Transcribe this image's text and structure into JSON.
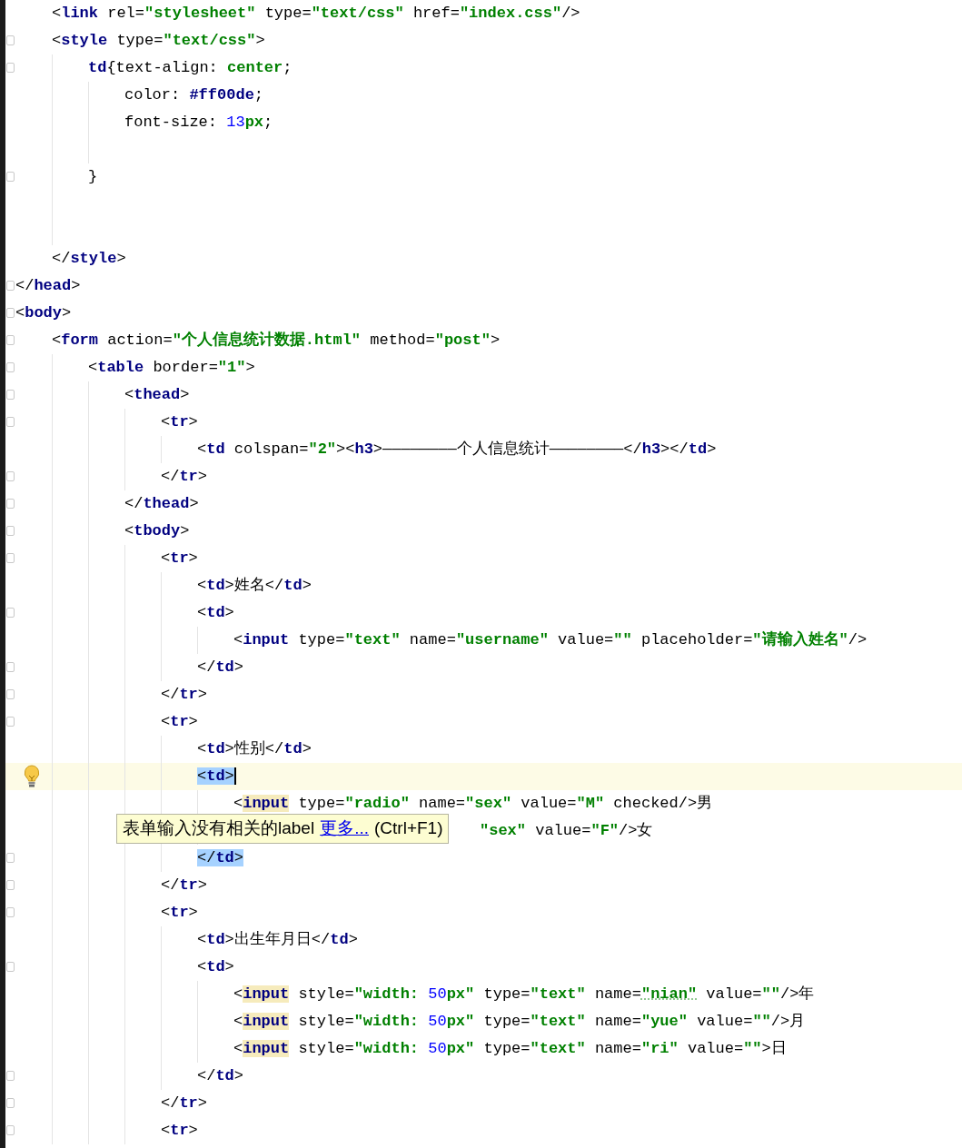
{
  "editor": {
    "lines": [
      {
        "children": [
          {
            "tokens": [
              {
                "kind": "p",
                "text": "<"
              },
              {
                "kind": "tag",
                "text": "link"
              },
              {
                "kind": "attr",
                "text": " rel="
              },
              {
                "kind": "str",
                "text": "\"stylesheet\""
              },
              {
                "kind": "attr",
                "text": " type="
              },
              {
                "kind": "str",
                "text": "\"text/css\""
              },
              {
                "kind": "attr",
                "text": " href="
              },
              {
                "kind": "str",
                "text": "\"index.css\""
              },
              {
                "kind": "p",
                "text": "/>"
              }
            ]
          },
          {
            "fold": true,
            "tokens": [
              {
                "kind": "p",
                "text": "<"
              },
              {
                "kind": "tag",
                "text": "style"
              },
              {
                "kind": "attr",
                "text": " type="
              },
              {
                "kind": "str",
                "text": "\"text/css\""
              },
              {
                "kind": "p",
                "text": ">"
              }
            ],
            "children": [
              {
                "fold": true,
                "tokens": [
                  {
                    "kind": "tag",
                    "text": "td"
                  },
                  {
                    "kind": "p",
                    "text": "{text-align: "
                  },
                  {
                    "kind": "str",
                    "text": "center"
                  },
                  {
                    "kind": "p",
                    "text": ";"
                  }
                ],
                "children": [
                  {
                    "tokens": [
                      {
                        "kind": "p",
                        "text": "color: "
                      },
                      {
                        "kind": "tag",
                        "text": "#ff00de"
                      },
                      {
                        "kind": "p",
                        "text": ";"
                      }
                    ]
                  },
                  {
                    "tokens": [
                      {
                        "kind": "p",
                        "text": "font-size: "
                      },
                      {
                        "kind": "num",
                        "text": "13"
                      },
                      {
                        "kind": "str",
                        "text": "px"
                      },
                      {
                        "kind": "p",
                        "text": ";"
                      }
                    ]
                  },
                  {
                    "kind": "blank"
                  }
                ]
              },
              {
                "fold": true,
                "tokens": [
                  {
                    "kind": "p",
                    "text": "}"
                  }
                ]
              },
              {
                "kind": "blank"
              },
              {
                "kind": "blank"
              }
            ]
          },
          {
            "tokens": [
              {
                "kind": "p",
                "text": "</"
              },
              {
                "kind": "tag",
                "text": "style"
              },
              {
                "kind": "p",
                "text": ">"
              }
            ]
          }
        ]
      },
      {
        "fold": true,
        "tokens": [
          {
            "kind": "p",
            "text": "</"
          },
          {
            "kind": "tag",
            "text": "head"
          },
          {
            "kind": "p",
            "text": ">"
          }
        ]
      },
      {
        "fold": true,
        "tokens": [
          {
            "kind": "p",
            "text": "<"
          },
          {
            "kind": "tag",
            "text": "body"
          },
          {
            "kind": "p",
            "text": ">"
          }
        ],
        "children": [
          {
            "fold": true,
            "tokens": [
              {
                "kind": "p",
                "text": "<"
              },
              {
                "kind": "tag",
                "text": "form"
              },
              {
                "kind": "attr",
                "text": " action="
              },
              {
                "kind": "str",
                "text": "\"个人信息统计数据.html\""
              },
              {
                "kind": "attr",
                "text": " method="
              },
              {
                "kind": "str",
                "text": "\"post\""
              },
              {
                "kind": "p",
                "text": ">"
              }
            ],
            "children": [
              {
                "fold": true,
                "tokens": [
                  {
                    "kind": "p",
                    "text": "<"
                  },
                  {
                    "kind": "tag",
                    "text": "table"
                  },
                  {
                    "kind": "attr",
                    "text": " border="
                  },
                  {
                    "kind": "str",
                    "text": "\"1\""
                  },
                  {
                    "kind": "p",
                    "text": ">"
                  }
                ],
                "children": [
                  {
                    "fold": true,
                    "tokens": [
                      {
                        "kind": "p",
                        "text": "<"
                      },
                      {
                        "kind": "tag",
                        "text": "thead"
                      },
                      {
                        "kind": "p",
                        "text": ">"
                      }
                    ],
                    "children": [
                      {
                        "fold": true,
                        "tokens": [
                          {
                            "kind": "p",
                            "text": "<"
                          },
                          {
                            "kind": "tag",
                            "text": "tr"
                          },
                          {
                            "kind": "p",
                            "text": ">"
                          }
                        ],
                        "children": [
                          {
                            "tokens": [
                              {
                                "kind": "p",
                                "text": "<"
                              },
                              {
                                "kind": "tag",
                                "text": "td"
                              },
                              {
                                "kind": "attr",
                                "text": " colspan="
                              },
                              {
                                "kind": "str",
                                "text": "\"2\""
                              },
                              {
                                "kind": "p",
                                "text": "><"
                              },
                              {
                                "kind": "tag",
                                "text": "h3"
                              },
                              {
                                "kind": "p",
                                "text": ">————————个人信息统计————————</"
                              },
                              {
                                "kind": "tag",
                                "text": "h3"
                              },
                              {
                                "kind": "p",
                                "text": "></"
                              },
                              {
                                "kind": "tag",
                                "text": "td"
                              },
                              {
                                "kind": "p",
                                "text": ">"
                              }
                            ]
                          }
                        ]
                      },
                      {
                        "fold": true,
                        "tokens": [
                          {
                            "kind": "p",
                            "text": "</"
                          },
                          {
                            "kind": "tag",
                            "text": "tr"
                          },
                          {
                            "kind": "p",
                            "text": ">"
                          }
                        ]
                      }
                    ]
                  },
                  {
                    "fold": true,
                    "tokens": [
                      {
                        "kind": "p",
                        "text": "</"
                      },
                      {
                        "kind": "tag",
                        "text": "thead"
                      },
                      {
                        "kind": "p",
                        "text": ">"
                      }
                    ]
                  },
                  {
                    "fold": true,
                    "tokens": [
                      {
                        "kind": "p",
                        "text": "<"
                      },
                      {
                        "kind": "tag",
                        "text": "tbody"
                      },
                      {
                        "kind": "p",
                        "text": ">"
                      }
                    ],
                    "children": [
                      {
                        "fold": true,
                        "tokens": [
                          {
                            "kind": "p",
                            "text": "<"
                          },
                          {
                            "kind": "tag",
                            "text": "tr"
                          },
                          {
                            "kind": "p",
                            "text": ">"
                          }
                        ],
                        "children": [
                          {
                            "tokens": [
                              {
                                "kind": "p",
                                "text": "<"
                              },
                              {
                                "kind": "tag",
                                "text": "td"
                              },
                              {
                                "kind": "p",
                                "text": ">姓名</"
                              },
                              {
                                "kind": "tag",
                                "text": "td"
                              },
                              {
                                "kind": "p",
                                "text": ">"
                              }
                            ]
                          },
                          {
                            "fold": true,
                            "tokens": [
                              {
                                "kind": "p",
                                "text": "<"
                              },
                              {
                                "kind": "tag",
                                "text": "td"
                              },
                              {
                                "kind": "p",
                                "text": ">"
                              }
                            ],
                            "children": [
                              {
                                "tokens": [
                                  {
                                    "kind": "p",
                                    "text": "<"
                                  },
                                  {
                                    "kind": "tag",
                                    "text": "input"
                                  },
                                  {
                                    "kind": "attr",
                                    "text": " type="
                                  },
                                  {
                                    "kind": "str",
                                    "text": "\"text\""
                                  },
                                  {
                                    "kind": "attr",
                                    "text": " name="
                                  },
                                  {
                                    "kind": "str",
                                    "text": "\"username\""
                                  },
                                  {
                                    "kind": "attr",
                                    "text": " value="
                                  },
                                  {
                                    "kind": "str",
                                    "text": "\"\""
                                  },
                                  {
                                    "kind": "attr",
                                    "text": " placeholder="
                                  },
                                  {
                                    "kind": "str",
                                    "text": "\"请输入姓名\""
                                  },
                                  {
                                    "kind": "p",
                                    "text": "/>"
                                  }
                                ]
                              }
                            ]
                          },
                          {
                            "fold": true,
                            "tokens": [
                              {
                                "kind": "p",
                                "text": "</"
                              },
                              {
                                "kind": "tag",
                                "text": "td"
                              },
                              {
                                "kind": "p",
                                "text": ">"
                              }
                            ]
                          }
                        ]
                      },
                      {
                        "fold": true,
                        "tokens": [
                          {
                            "kind": "p",
                            "text": "</"
                          },
                          {
                            "kind": "tag",
                            "text": "tr"
                          },
                          {
                            "kind": "p",
                            "text": ">"
                          }
                        ]
                      },
                      {
                        "fold": true,
                        "tokens": [
                          {
                            "kind": "p",
                            "text": "<"
                          },
                          {
                            "kind": "tag",
                            "text": "tr"
                          },
                          {
                            "kind": "p",
                            "text": ">"
                          }
                        ],
                        "children": [
                          {
                            "tokens": [
                              {
                                "kind": "p",
                                "text": "<"
                              },
                              {
                                "kind": "tag",
                                "text": "td"
                              },
                              {
                                "kind": "p",
                                "text": ">性别</"
                              },
                              {
                                "kind": "tag",
                                "text": "td"
                              },
                              {
                                "kind": "p",
                                "text": ">"
                              }
                            ]
                          },
                          {
                            "current": true,
                            "bulb": true,
                            "tokens": [
                              {
                                "kind": "p",
                                "text": "<",
                                "selected": true
                              },
                              {
                                "kind": "tag",
                                "text": "td",
                                "selected": true
                              },
                              {
                                "kind": "p",
                                "text": ">",
                                "selected": true,
                                "caret": true
                              }
                            ],
                            "children": [
                              {
                                "tokens": [
                                  {
                                    "kind": "p",
                                    "text": "<"
                                  },
                                  {
                                    "kind": "tag",
                                    "text": "input",
                                    "warning": true
                                  },
                                  {
                                    "kind": "attr",
                                    "text": " type="
                                  },
                                  {
                                    "kind": "str",
                                    "text": "\"radio\""
                                  },
                                  {
                                    "kind": "attr",
                                    "text": " name="
                                  },
                                  {
                                    "kind": "str",
                                    "text": "\"sex\""
                                  },
                                  {
                                    "kind": "attr",
                                    "text": " value="
                                  },
                                  {
                                    "kind": "str",
                                    "text": "\"M\""
                                  },
                                  {
                                    "kind": "attr",
                                    "text": " checked/>男"
                                  }
                                ]
                              },
                              {
                                "tokens": [
                                  {
                                    "kind": "gap"
                                  },
                                  {
                                    "kind": "str",
                                    "text": "\"sex\""
                                  },
                                  {
                                    "kind": "attr",
                                    "text": " value="
                                  },
                                  {
                                    "kind": "str",
                                    "text": "\"F\""
                                  },
                                  {
                                    "kind": "p",
                                    "text": "/>女"
                                  }
                                ]
                              }
                            ]
                          },
                          {
                            "fold": true,
                            "tokens": [
                              {
                                "kind": "p",
                                "text": "</",
                                "selected": true
                              },
                              {
                                "kind": "tag",
                                "text": "td",
                                "selected": true
                              },
                              {
                                "kind": "p",
                                "text": ">",
                                "selected": true
                              }
                            ]
                          }
                        ]
                      },
                      {
                        "fold": true,
                        "tokens": [
                          {
                            "kind": "p",
                            "text": "</"
                          },
                          {
                            "kind": "tag",
                            "text": "tr"
                          },
                          {
                            "kind": "p",
                            "text": ">"
                          }
                        ]
                      },
                      {
                        "fold": true,
                        "tokens": [
                          {
                            "kind": "p",
                            "text": "<"
                          },
                          {
                            "kind": "tag",
                            "text": "tr"
                          },
                          {
                            "kind": "p",
                            "text": ">"
                          }
                        ],
                        "children": [
                          {
                            "tokens": [
                              {
                                "kind": "p",
                                "text": "<"
                              },
                              {
                                "kind": "tag",
                                "text": "td"
                              },
                              {
                                "kind": "p",
                                "text": ">出生年月日</"
                              },
                              {
                                "kind": "tag",
                                "text": "td"
                              },
                              {
                                "kind": "p",
                                "text": ">"
                              }
                            ]
                          },
                          {
                            "fold": true,
                            "tokens": [
                              {
                                "kind": "p",
                                "text": "<"
                              },
                              {
                                "kind": "tag",
                                "text": "td"
                              },
                              {
                                "kind": "p",
                                "text": ">"
                              }
                            ],
                            "children": [
                              {
                                "tokens": [
                                  {
                                    "kind": "p",
                                    "text": "<"
                                  },
                                  {
                                    "kind": "tag",
                                    "text": "input",
                                    "warning": true
                                  },
                                  {
                                    "kind": "attr",
                                    "text": " style="
                                  },
                                  {
                                    "kind": "str",
                                    "text": "\"width: "
                                  },
                                  {
                                    "kind": "num",
                                    "text": "50"
                                  },
                                  {
                                    "kind": "str",
                                    "text": "px\""
                                  },
                                  {
                                    "kind": "attr",
                                    "text": " type="
                                  },
                                  {
                                    "kind": "str",
                                    "text": "\"text\""
                                  },
                                  {
                                    "kind": "attr",
                                    "text": " name="
                                  },
                                  {
                                    "kind": "str",
                                    "text": "\"nian\"",
                                    "typo": true
                                  },
                                  {
                                    "kind": "attr",
                                    "text": " value="
                                  },
                                  {
                                    "kind": "str",
                                    "text": "\"\""
                                  },
                                  {
                                    "kind": "p",
                                    "text": "/>年"
                                  }
                                ]
                              },
                              {
                                "tokens": [
                                  {
                                    "kind": "p",
                                    "text": "<"
                                  },
                                  {
                                    "kind": "tag",
                                    "text": "input",
                                    "warning": true
                                  },
                                  {
                                    "kind": "attr",
                                    "text": " style="
                                  },
                                  {
                                    "kind": "str",
                                    "text": "\"width: "
                                  },
                                  {
                                    "kind": "num",
                                    "text": "50"
                                  },
                                  {
                                    "kind": "str",
                                    "text": "px\""
                                  },
                                  {
                                    "kind": "attr",
                                    "text": " type="
                                  },
                                  {
                                    "kind": "str",
                                    "text": "\"text\""
                                  },
                                  {
                                    "kind": "attr",
                                    "text": " name="
                                  },
                                  {
                                    "kind": "str",
                                    "text": "\"yue\""
                                  },
                                  {
                                    "kind": "attr",
                                    "text": " value="
                                  },
                                  {
                                    "kind": "str",
                                    "text": "\"\""
                                  },
                                  {
                                    "kind": "p",
                                    "text": "/>月"
                                  }
                                ]
                              },
                              {
                                "tokens": [
                                  {
                                    "kind": "p",
                                    "text": "<"
                                  },
                                  {
                                    "kind": "tag",
                                    "text": "input",
                                    "warning": true
                                  },
                                  {
                                    "kind": "attr",
                                    "text": " style="
                                  },
                                  {
                                    "kind": "str",
                                    "text": "\"width: "
                                  },
                                  {
                                    "kind": "num",
                                    "text": "50"
                                  },
                                  {
                                    "kind": "str",
                                    "text": "px\""
                                  },
                                  {
                                    "kind": "attr",
                                    "text": " type="
                                  },
                                  {
                                    "kind": "str",
                                    "text": "\"text\""
                                  },
                                  {
                                    "kind": "attr",
                                    "text": " name="
                                  },
                                  {
                                    "kind": "str",
                                    "text": "\"ri\""
                                  },
                                  {
                                    "kind": "attr",
                                    "text": " value="
                                  },
                                  {
                                    "kind": "str",
                                    "text": "\"\""
                                  },
                                  {
                                    "kind": "p",
                                    "text": ">日"
                                  }
                                ]
                              }
                            ]
                          },
                          {
                            "fold": true,
                            "tokens": [
                              {
                                "kind": "p",
                                "text": "</"
                              },
                              {
                                "kind": "tag",
                                "text": "td"
                              },
                              {
                                "kind": "p",
                                "text": ">"
                              }
                            ]
                          }
                        ]
                      },
                      {
                        "fold": true,
                        "tokens": [
                          {
                            "kind": "p",
                            "text": "</"
                          },
                          {
                            "kind": "tag",
                            "text": "tr"
                          },
                          {
                            "kind": "p",
                            "text": ">"
                          }
                        ]
                      },
                      {
                        "fold": true,
                        "tokens": [
                          {
                            "kind": "p",
                            "text": "<"
                          },
                          {
                            "kind": "tag",
                            "text": "tr"
                          },
                          {
                            "kind": "p",
                            "text": ">"
                          }
                        ]
                      }
                    ]
                  }
                ]
              }
            ]
          }
        ]
      }
    ]
  },
  "tooltip": {
    "message": "表单输入没有相关的label",
    "link": "更多...",
    "shortcut": "(Ctrl+F1)"
  }
}
